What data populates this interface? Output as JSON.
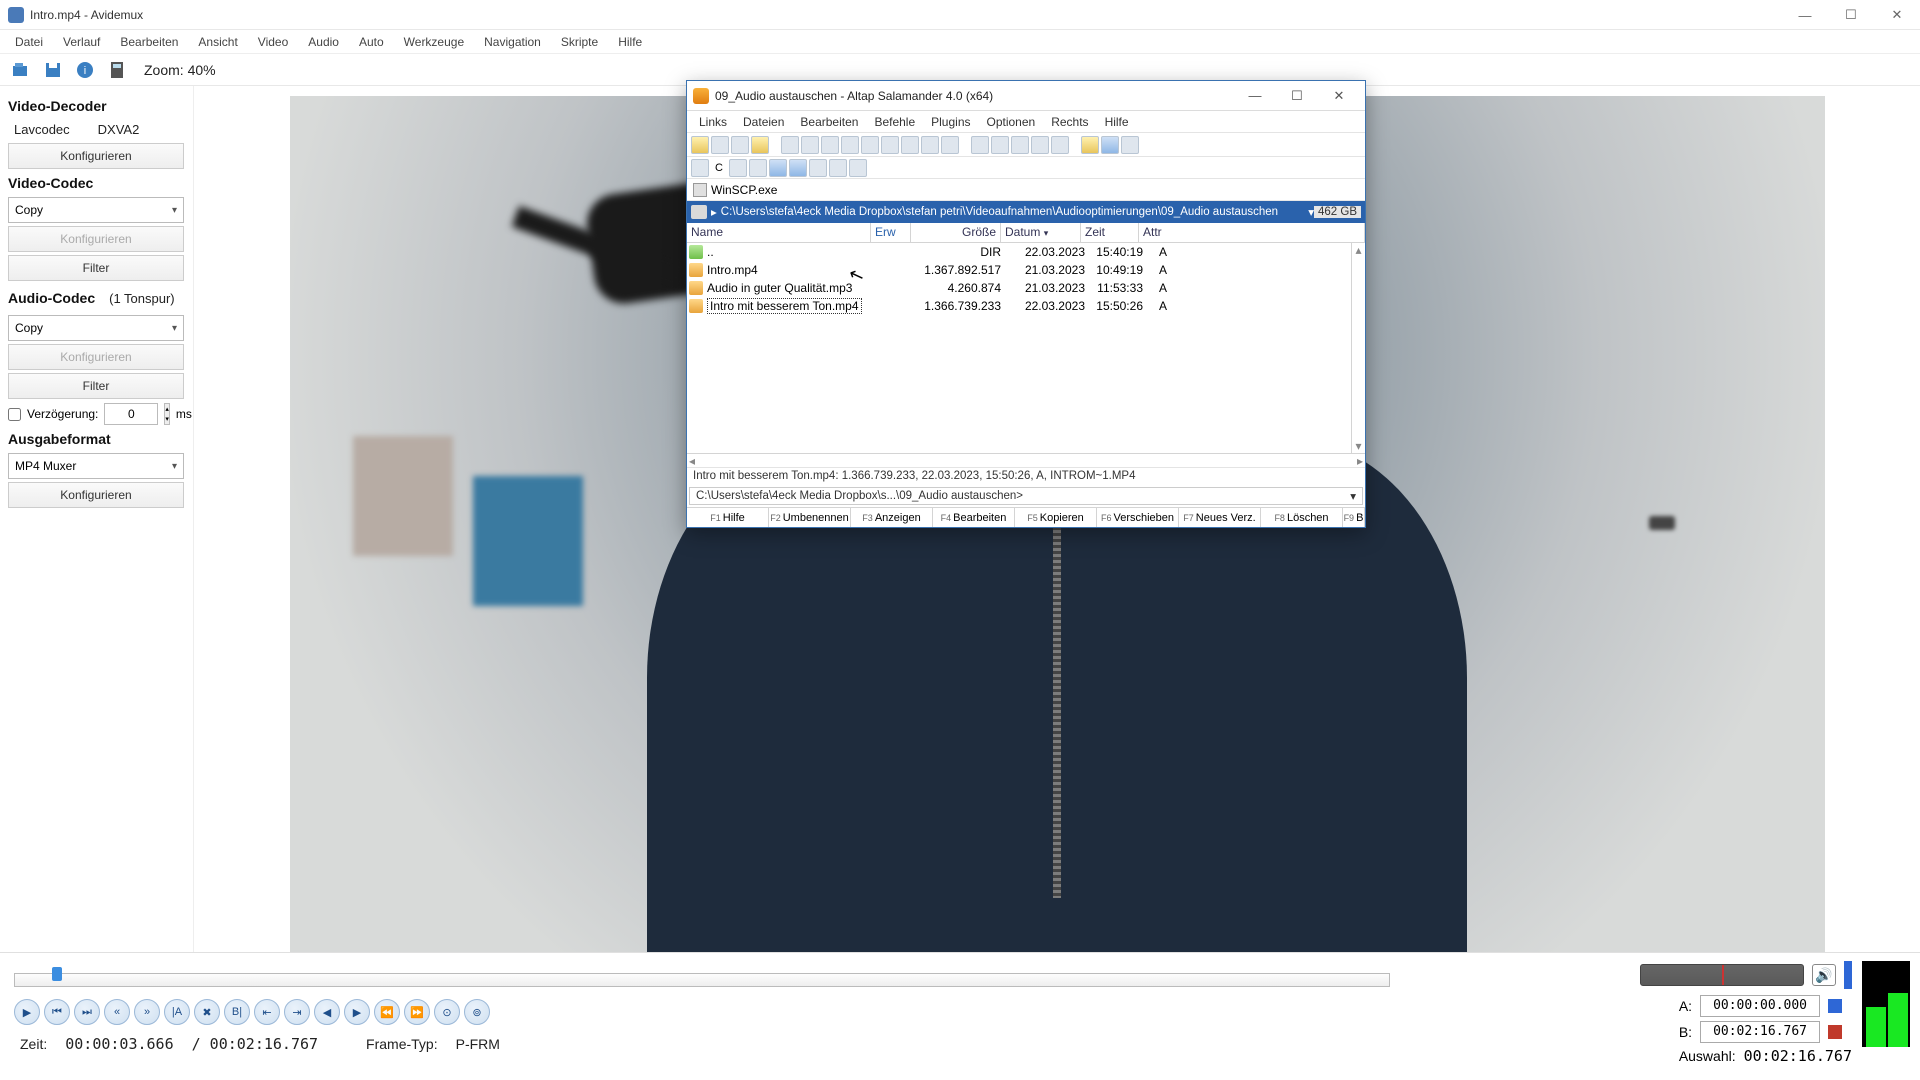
{
  "window": {
    "title": "Intro.mp4 - Avidemux"
  },
  "menu": [
    "Datei",
    "Verlauf",
    "Bearbeiten",
    "Ansicht",
    "Video",
    "Audio",
    "Auto",
    "Werkzeuge",
    "Navigation",
    "Skripte",
    "Hilfe"
  ],
  "topbar": {
    "zoom": "Zoom: 40%"
  },
  "sidebar": {
    "decoder": {
      "header": "Video-Decoder",
      "codec": "Lavcodec",
      "hw": "DXVA2",
      "configure": "Konfigurieren"
    },
    "vcodec": {
      "header": "Video-Codec",
      "value": "Copy",
      "configure": "Konfigurieren",
      "filter": "Filter"
    },
    "acodec": {
      "header": "Audio-Codec",
      "tracks": "(1 Tonspur)",
      "value": "Copy",
      "configure": "Konfigurieren",
      "filter": "Filter",
      "delay_label": "Verzögerung:",
      "delay_value": "0",
      "delay_unit": "ms"
    },
    "output": {
      "header": "Ausgabeformat",
      "value": "MP4 Muxer",
      "configure": "Konfigurieren"
    }
  },
  "status": {
    "time_label": "Zeit:",
    "time": "00:00:03.666",
    "duration": "/ 00:02:16.767",
    "frame_label": "Frame-Typ:",
    "frame_type": "P-FRM"
  },
  "ab": {
    "a_label": "A:",
    "a": "00:00:00.000",
    "b_label": "B:",
    "b": "00:02:16.767",
    "sel_label": "Auswahl:",
    "sel": "00:02:16.767"
  },
  "fm": {
    "title": "09_Audio austauschen - Altap Salamander 4.0 (x64)",
    "menu": [
      "Links",
      "Dateien",
      "Bearbeiten",
      "Befehle",
      "Plugins",
      "Optionen",
      "Rechts",
      "Hilfe"
    ],
    "quick": "WinSCP.exe",
    "path": "C:\\Users\\stefa\\4eck Media Dropbox\\stefan petri\\Videoaufnahmen\\Audiooptimierungen\\09_Audio austauschen",
    "disk_free": "462 GB",
    "cols": {
      "name": "Name",
      "ext": "Erw",
      "size": "Größe",
      "date": "Datum",
      "time": "Zeit",
      "attr": "Attr"
    },
    "rows": [
      {
        "name": "..",
        "ext": "",
        "size": "DIR",
        "date": "22.03.2023",
        "time": "15:40:19",
        "attr": "A",
        "up": true
      },
      {
        "name": "Intro.mp4",
        "size": "1.367.892.517",
        "date": "21.03.2023",
        "time": "10:49:19",
        "attr": "A"
      },
      {
        "name": "Audio in guter Qualität.mp3",
        "size": "4.260.874",
        "date": "21.03.2023",
        "time": "11:53:33",
        "attr": "A"
      },
      {
        "name": "Intro mit besserem Ton.mp4",
        "size": "1.366.739.233",
        "date": "22.03.2023",
        "time": "15:50:26",
        "attr": "A",
        "selected": true
      }
    ],
    "info": "Intro mit besserem Ton.mp4: 1.366.739.233, 22.03.2023, 15:50:26, A, INTROM~1.MP4",
    "cmdline": "C:\\Users\\stefa\\4eck Media Dropbox\\s...\\09_Audio austauschen>",
    "fkeys": [
      "Hilfe",
      "Umbenennen",
      "Anzeigen",
      "Bearbeiten",
      "Kopieren",
      "Verschieben",
      "Neues Verz.",
      "Löschen",
      "B"
    ]
  }
}
